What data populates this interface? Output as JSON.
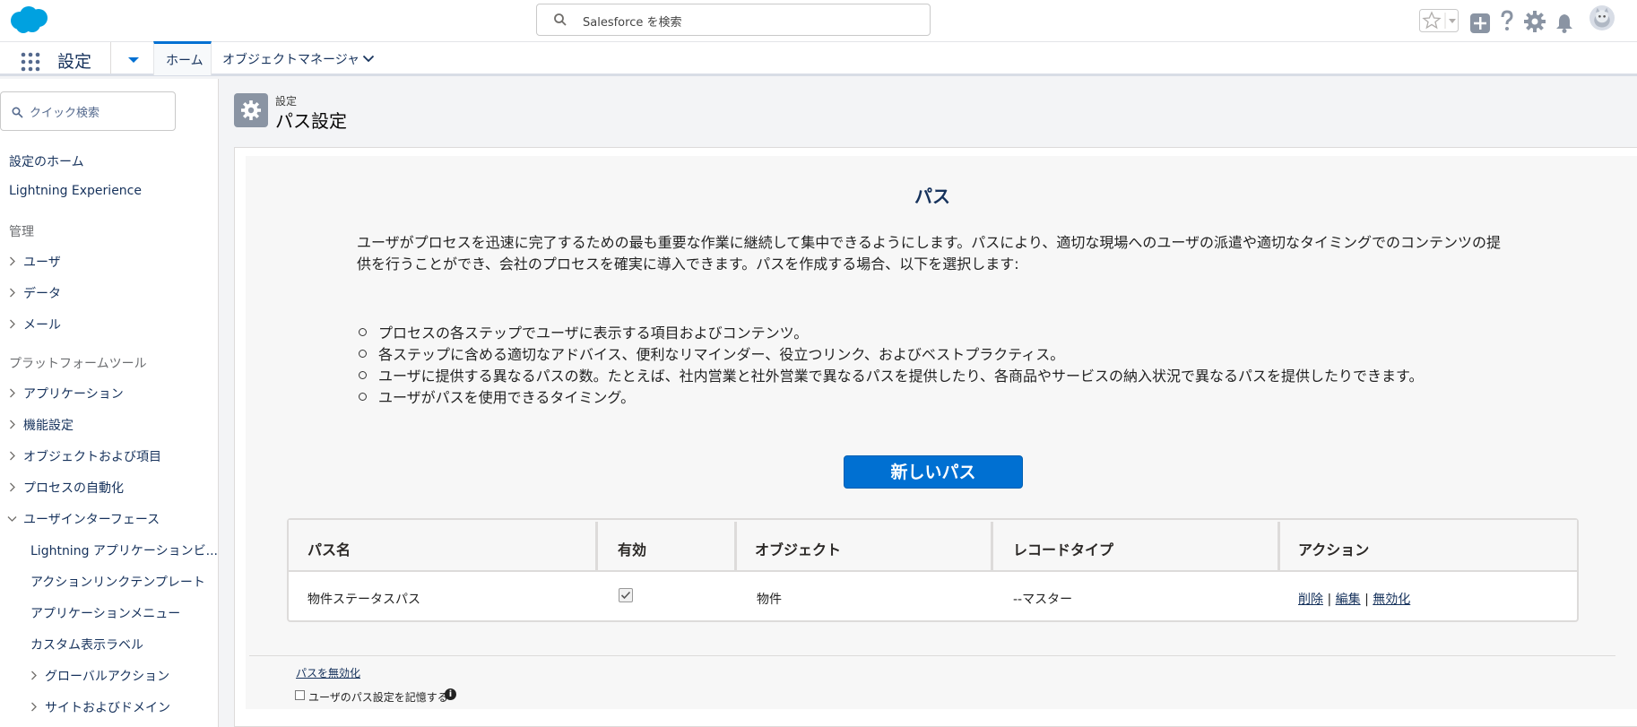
{
  "header": {
    "search_placeholder": "Salesforce を検索"
  },
  "nav": {
    "app_title": "設定",
    "tabs": [
      {
        "label": "ホーム"
      },
      {
        "label": "オブジェクトマネージャ"
      }
    ]
  },
  "sidebar": {
    "quick_search_placeholder": "クイック検索",
    "top_items": [
      "設定のホーム",
      "Lightning Experience"
    ],
    "section_admin": "管理",
    "admin_items": [
      "ユーザ",
      "データ",
      "メール"
    ],
    "section_platform": "プラットフォームツール",
    "platform_items": [
      "アプリケーション",
      "機能設定",
      "オブジェクトおよび項目",
      "プロセスの自動化",
      "ユーザインターフェース"
    ],
    "ui_subitems": [
      "Lightning アプリケーションビ...",
      "アクションリンクテンプレート",
      "アプリケーションメニュー",
      "カスタム表示ラベル"
    ],
    "ui_expandable_subitems": [
      "グローバルアクション",
      "サイトおよびドメイン"
    ]
  },
  "page": {
    "breadcrumb": "設定",
    "title": "パス設定"
  },
  "content": {
    "section_title": "パス",
    "description": "ユーザがプロセスを迅速に完了するための最も重要な作業に継続して集中できるようにします。パスにより、適切な現場へのユーザの派遣や適切なタイミングでのコンテンツの提供を行うことができ、会社のプロセスを確実に導入できます。パスを作成する場合、以下を選択します:",
    "bullets": [
      "プロセスの各ステップでユーザに表示する項目およびコンテンツ。",
      "各ステップに含める適切なアドバイス、便利なリマインダー、役立つリンク、およびベストプラクティス。",
      "ユーザに提供する異なるパスの数。たとえば、社内営業と社外営業で異なるパスを提供したり、各商品やサービスの納入状況で異なるパスを提供したりできます。",
      "ユーザがパスを使用できるタイミング。"
    ],
    "new_path_button": "新しいパス"
  },
  "table": {
    "headers": [
      "パス名",
      "有効",
      "オブジェクト",
      "レコードタイプ",
      "アクション"
    ],
    "rows": [
      {
        "name": "物件ステータスパス",
        "active": true,
        "object": "物件",
        "record_type": "--マスター",
        "actions": [
          "削除",
          "編集",
          "無効化"
        ],
        "separator": "|"
      }
    ]
  },
  "footer": {
    "disable_link": "パスを無効化",
    "remember_label": "ユーザのパス設定を記憶する"
  },
  "colors": {
    "brand_blue": "#0070d2",
    "logo_blue": "#00a1e0",
    "sidebar_bg": "#ffffff",
    "page_bg": "#f3f4f6"
  }
}
